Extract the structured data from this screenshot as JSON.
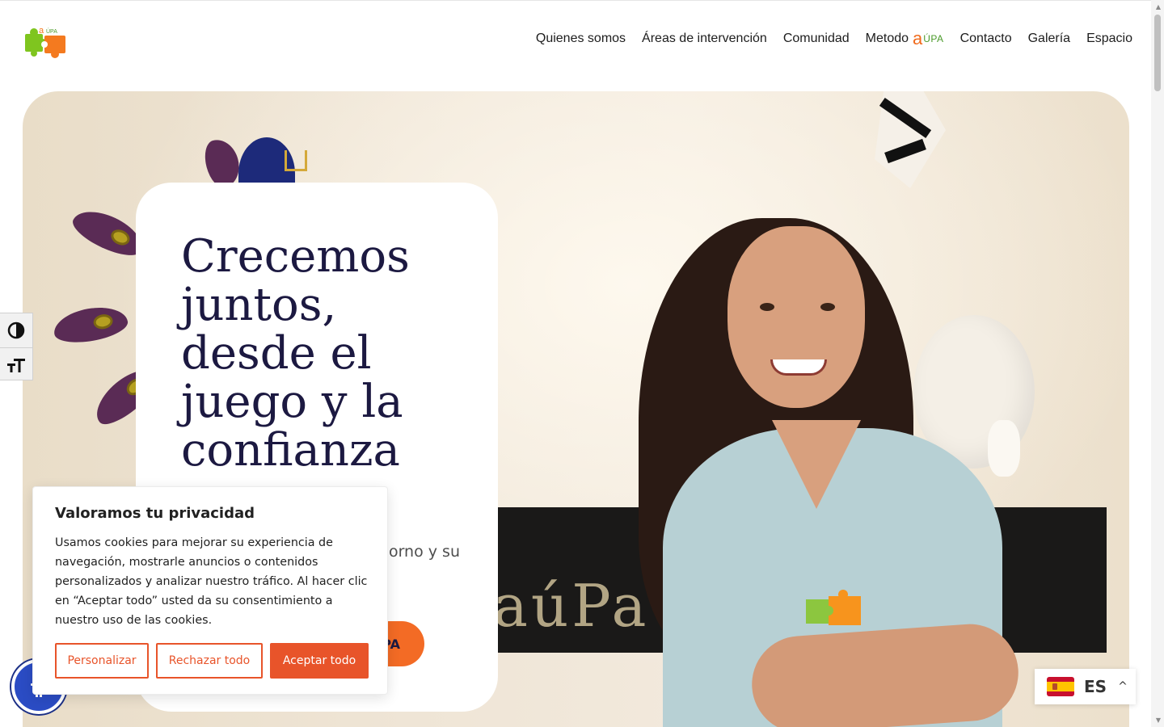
{
  "header": {
    "logo_alt": "aÚPA",
    "nav": [
      {
        "label": "Quienes somos"
      },
      {
        "label": "Áreas de intervención"
      },
      {
        "label": "Comunidad"
      },
      {
        "label": "Metodo",
        "brand_a": "a",
        "brand_upa": "ÚPA"
      },
      {
        "label": "Contacto"
      },
      {
        "label": "Galería"
      },
      {
        "label": "Espacio"
      }
    ]
  },
  "hero": {
    "title": "Crecemos juntos, desde el juego y la confianza",
    "subtitle": "orno y su",
    "cta_label": "PA",
    "chalk_text": "aúPa"
  },
  "accessibility": {
    "contrast_icon": "contrast-icon",
    "font_size_icon": "font-size-icon",
    "round_button_icon": "accessibility-person-icon"
  },
  "cookie_banner": {
    "title": "Valoramos tu privacidad",
    "text": "Usamos cookies para mejorar su experiencia de navegación, mostrarle anuncios o contenidos personalizados y analizar nuestro tráfico. Al hacer clic en “Aceptar todo” usted da su consentimiento a nuestro uso de las cookies.",
    "buttons": {
      "customize": "Personalizar",
      "reject": "Rechazar todo",
      "accept": "Aceptar todo"
    }
  },
  "language": {
    "code": "ES",
    "flag": "spain-flag-icon"
  },
  "colors": {
    "accent_orange": "#f36b25",
    "cookie_orange": "#e8542a",
    "title_navy": "#1c1941",
    "brand_green": "#4a9a2a"
  }
}
